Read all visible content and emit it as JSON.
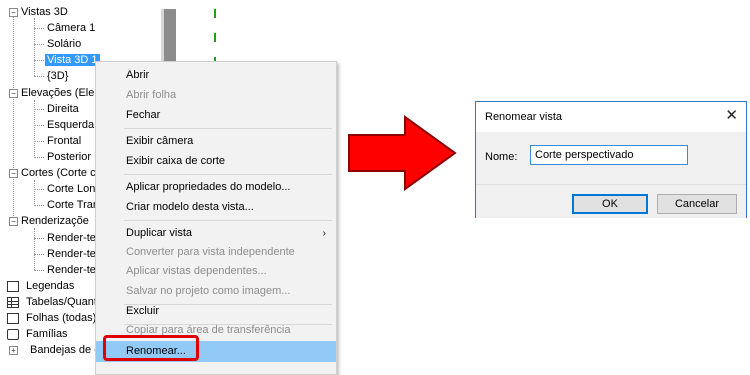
{
  "tree": {
    "vistas3d": "Vistas 3D",
    "camera1": "Câmera 1",
    "solario": "Solário",
    "vista3d1": "Vista 3D 1",
    "v3d": "{3D}",
    "elevacoes": "Elevações (Ele",
    "direita": "Direita",
    "esquerda": "Esquerda",
    "frontal": "Frontal",
    "posterior": "Posterior",
    "cortes": "Cortes (Corte c",
    "corte_lon": "Corte Lon",
    "corte_tran": "Corte Tran",
    "renderizacoes": "Renderizaçõe",
    "render1": "Render-te",
    "render2": "Render-te",
    "render3": "Render-te",
    "legendas": "Legendas",
    "tabelas": "Tabelas/Quant",
    "folhas": "Folhas (todas)",
    "familias": "Famílias",
    "bandejas": "Bandejas de c"
  },
  "menu": {
    "items": [
      {
        "label": "Abrir",
        "enabled": true
      },
      {
        "label": "Abrir folha",
        "enabled": false
      },
      {
        "label": "Fechar",
        "enabled": true
      },
      {
        "label": "Exibir câmera",
        "enabled": true
      },
      {
        "label": "Exibir caixa de corte",
        "enabled": true
      },
      {
        "label": "Aplicar propriedades do modelo...",
        "enabled": true
      },
      {
        "label": "Criar modelo desta vista...",
        "enabled": true
      },
      {
        "label": "Duplicar vista",
        "enabled": true
      },
      {
        "label": "Converter para vista independente",
        "enabled": false
      },
      {
        "label": "Aplicar vistas dependentes...",
        "enabled": false
      },
      {
        "label": "Salvar no projeto como imagem...",
        "enabled": false
      },
      {
        "label": "Excluir",
        "enabled": true
      },
      {
        "label": "Copiar para área de transferência",
        "enabled": false
      },
      {
        "label": "Renomear...",
        "enabled": true
      }
    ],
    "submenu_arrow": "›"
  },
  "dialog": {
    "title": "Renomear vista",
    "close": "✕",
    "name_label": "Nome:",
    "name_value": "Corte perspectivado",
    "ok": "OK",
    "cancel": "Cancelar"
  },
  "colors": {
    "selection": "#3399ff",
    "menu_highlight": "#91c9f7",
    "red_annotation": "#e00000",
    "arrow_red": "#ff0000",
    "dialog_border": "#2b78c5"
  }
}
